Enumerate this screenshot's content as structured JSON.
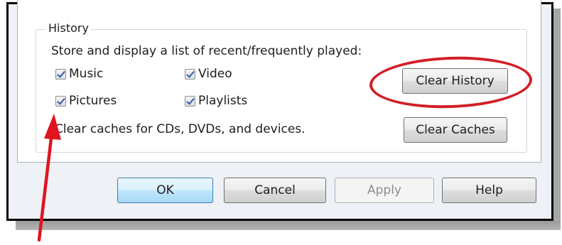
{
  "history": {
    "group_title": "History",
    "description": "Store and display a list of recent/frequently played:",
    "checkboxes": [
      {
        "label": "Music",
        "checked": true
      },
      {
        "label": "Video",
        "checked": true
      },
      {
        "label": "Pictures",
        "checked": true
      },
      {
        "label": "Playlists",
        "checked": true
      }
    ],
    "clear_history_label": "Clear History",
    "caches_text": "Clear caches for CDs, DVDs, and devices.",
    "clear_caches_label": "Clear Caches"
  },
  "dialog_buttons": {
    "ok": "OK",
    "cancel": "Cancel",
    "apply": "Apply",
    "help": "Help"
  },
  "annotations": {
    "highlight_color": "#d11f27",
    "arrow_color": "#e0141e"
  }
}
